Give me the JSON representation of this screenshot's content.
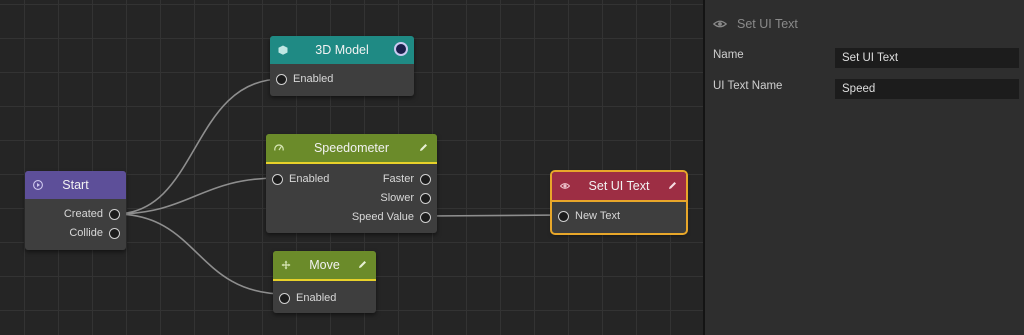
{
  "nodes": {
    "model": {
      "title": "3D Model",
      "color": "#1f8a84",
      "inputs": [
        "Enabled"
      ]
    },
    "speedometer": {
      "title": "Speedometer",
      "color": "#6b8b2a",
      "inputs": [
        "Enabled"
      ],
      "outputs": [
        "Faster",
        "Slower",
        "Speed Value"
      ]
    },
    "start": {
      "title": "Start",
      "color": "#5d4f99",
      "outputs": [
        "Created",
        "Collide"
      ]
    },
    "move": {
      "title": "Move",
      "color": "#6b8b2a",
      "inputs": [
        "Enabled"
      ]
    },
    "set_ui_text": {
      "title": "Set UI Text",
      "color": "#9d2e44",
      "inputs": [
        "New Text"
      ],
      "selected": true
    }
  },
  "panel": {
    "title": "Set UI Text",
    "properties": [
      {
        "label": "Name",
        "value": "Set UI Text"
      },
      {
        "label": "UI Text Name",
        "value": "Speed"
      }
    ]
  },
  "colors": {
    "selection": "#e8a72a",
    "accent_underline": "#e8d12a"
  }
}
